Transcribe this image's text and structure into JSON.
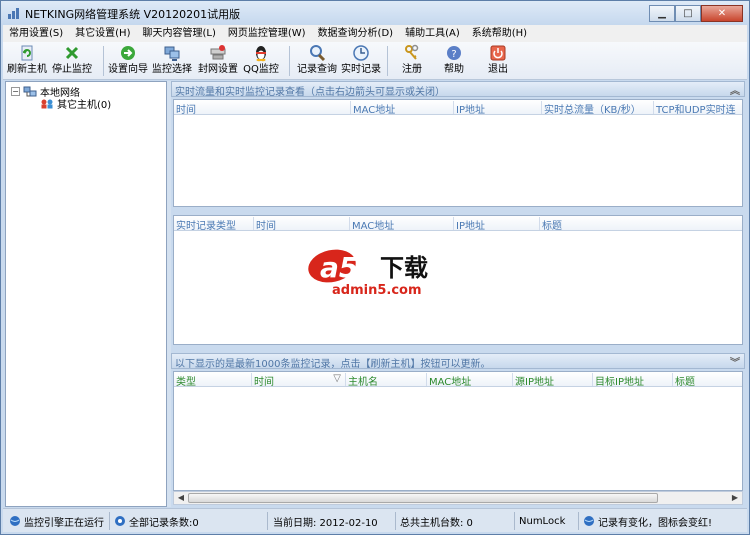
{
  "window": {
    "title": "NETKING网络管理系统 V20120201试用版",
    "controls": {
      "minimize": "▁",
      "maximize": "□",
      "close": "✕"
    }
  },
  "menu": [
    "常用设置(S)",
    "其它设置(H)",
    "聊天内容管理(L)",
    "网页监控管理(W)",
    "数据查询分析(D)",
    "辅助工具(A)",
    "系统帮助(H)"
  ],
  "toolbar": {
    "refresh": "刷新主机",
    "stop": "停止监控",
    "wizard": "设置向导",
    "monitor_select": "监控选择",
    "block_net": "封网设置",
    "qq_monitor": "QQ监控",
    "record_query": "记录查询",
    "realtime_record": "实时记录",
    "register": "注册",
    "help": "帮助",
    "exit": "退出"
  },
  "tree": {
    "root": "本地网络",
    "child": "其它主机(0)",
    "expander": "−"
  },
  "traffic_panel": {
    "header": "实时流量和实时监控记录查看（点击右边箭头可显示或关闭）",
    "chevron": "︽",
    "columns": [
      "时间",
      "MAC地址",
      "IP地址",
      "实时总流量（KB/秒）",
      "TCP和UDP实时连"
    ]
  },
  "realtime_panel": {
    "columns": [
      "实时记录类型",
      "时间",
      "MAC地址",
      "IP地址",
      "标题"
    ]
  },
  "watermark": {
    "logo": "a5",
    "cn": "下载",
    "url": "admin5.com"
  },
  "records_panel": {
    "header": "以下显示的是最新1000条监控记录，点击【刷新主机】按钮可以更新。",
    "chevron": "︾",
    "columns": [
      "类型",
      "时间",
      "主机名",
      "MAC地址",
      "源IP地址",
      "目标IP地址",
      "标题"
    ],
    "sort_glyph": "▽"
  },
  "scroll": {
    "left": "◀",
    "right": "▶"
  },
  "status": {
    "engine": "监控引擎正在运行",
    "total_records": "全部记录条数:0",
    "date": "当前日期:  2012-02-10",
    "hosts": "总共主机台数:  0",
    "numlock": "NumLock",
    "note": "记录有变化，图标会变红!"
  },
  "colors": {
    "panel_text": "#5177a6",
    "grid_header_blue": "#4a79b3",
    "grid_header_green": "#2d8a2d",
    "watermark_red": "#d8261b"
  }
}
